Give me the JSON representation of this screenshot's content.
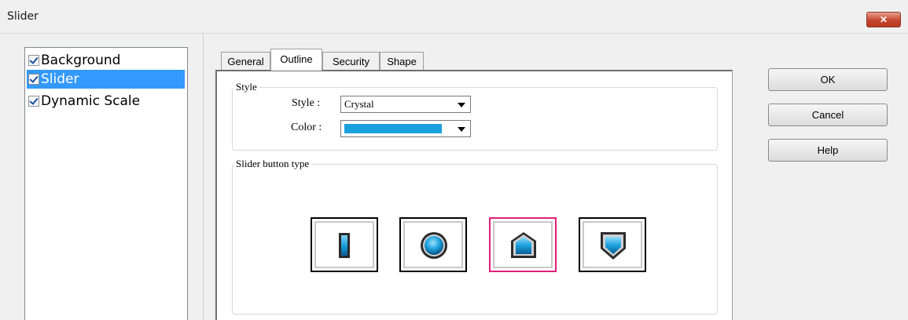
{
  "window": {
    "title": "Slider",
    "close_glyph": "✕"
  },
  "tree": {
    "items": [
      {
        "label": "Background",
        "checked": true
      },
      {
        "label": "Slider",
        "checked": true,
        "selected": true
      },
      {
        "label": "Dynamic Scale",
        "checked": true
      }
    ]
  },
  "tabs": [
    {
      "label": "General"
    },
    {
      "label": "Outline",
      "active": true
    },
    {
      "label": "Security"
    },
    {
      "label": "Shape"
    }
  ],
  "style_group": {
    "title": "Style",
    "style_label": "Style :",
    "style_value": "Crystal",
    "color_label": "Color :",
    "color_value": "#1aa0dc"
  },
  "button_type_group": {
    "title": "Slider button type",
    "options": [
      {
        "icon": "rectangle-knob-icon",
        "selected": false
      },
      {
        "icon": "circle-knob-icon",
        "selected": false
      },
      {
        "icon": "pentagon-up-knob-icon",
        "selected": true
      },
      {
        "icon": "shield-knob-icon",
        "selected": false
      }
    ]
  },
  "buttons": {
    "ok": "OK",
    "cancel": "Cancel",
    "help": "Help"
  },
  "colors": {
    "accent": "#1aa0dc",
    "selection": "#3399ff",
    "selected_border": "#e0207a"
  }
}
